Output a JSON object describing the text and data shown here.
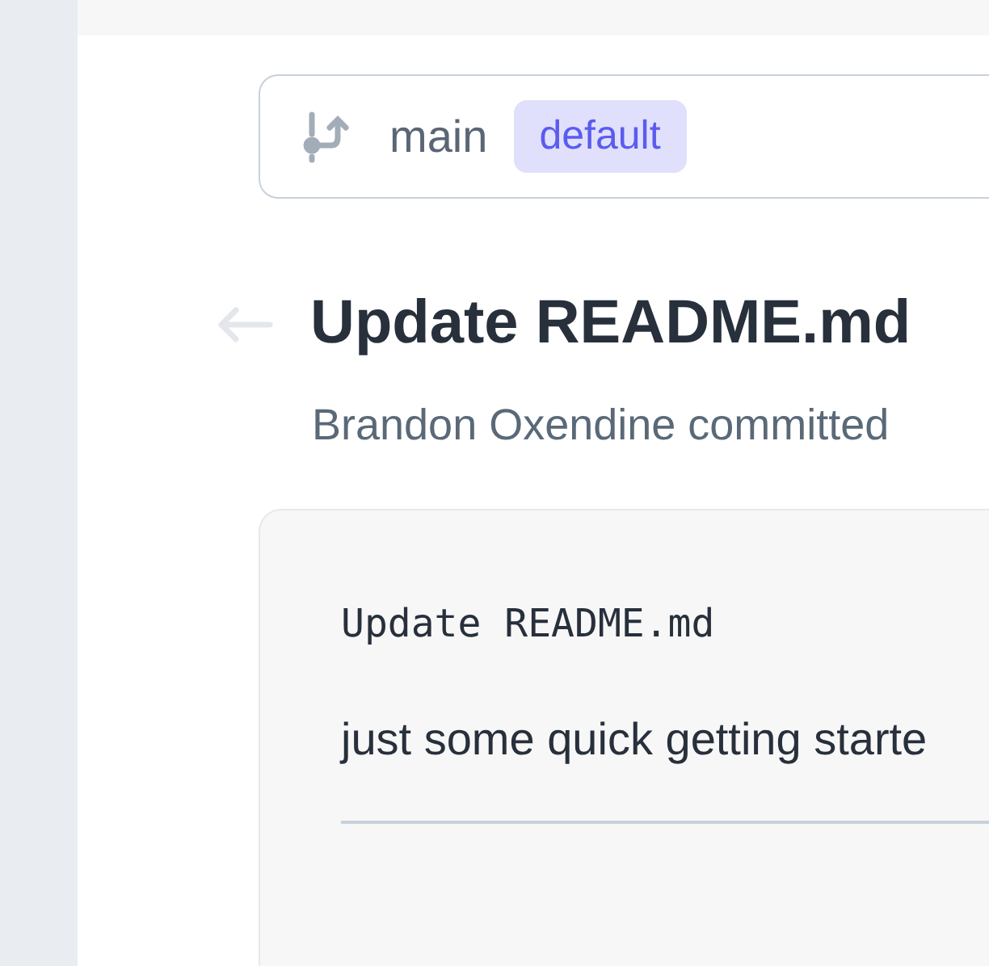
{
  "branch": {
    "name": "main",
    "badge": "default"
  },
  "commit": {
    "title": "Update README.md",
    "byline": "Brandon Oxendine committed",
    "message_title": "Update README.md",
    "message_body": "just some quick getting starte"
  }
}
